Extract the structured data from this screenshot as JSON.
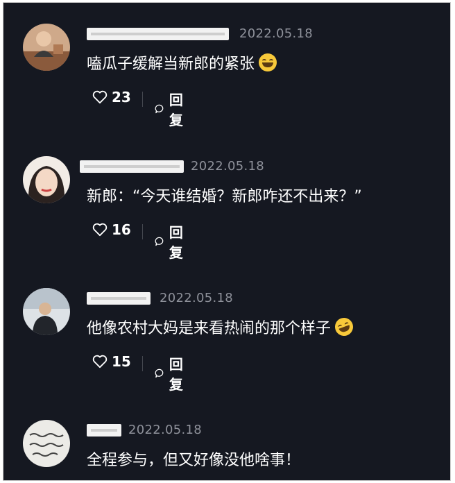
{
  "comments": [
    {
      "date": "2022.05.18",
      "text": "嗑瓜子缓解当新郎的紧张",
      "emoji": "grinning-emoji",
      "likes": "23",
      "reply": "回复"
    },
    {
      "date": "2022.05.18",
      "text": "新郎：“今天谁结婚？新郎咋还不出来？”",
      "emoji": "",
      "likes": "16",
      "reply": "回复"
    },
    {
      "date": "2022.05.18",
      "text": "他像农村大妈是来看热闹的那个样子",
      "emoji": "laughing-tears-emoji",
      "likes": "15",
      "reply": "回复"
    },
    {
      "date": "2022.05.18",
      "text": "全程参与，但又好像没他啥事！",
      "emoji": "",
      "likes": "",
      "reply": ""
    }
  ],
  "icons": {
    "like": "heart-outline-icon",
    "reply": "speech-bubble-icon"
  },
  "colors": {
    "background": "#151821",
    "text": "#ffffff",
    "meta": "#8e919a"
  }
}
